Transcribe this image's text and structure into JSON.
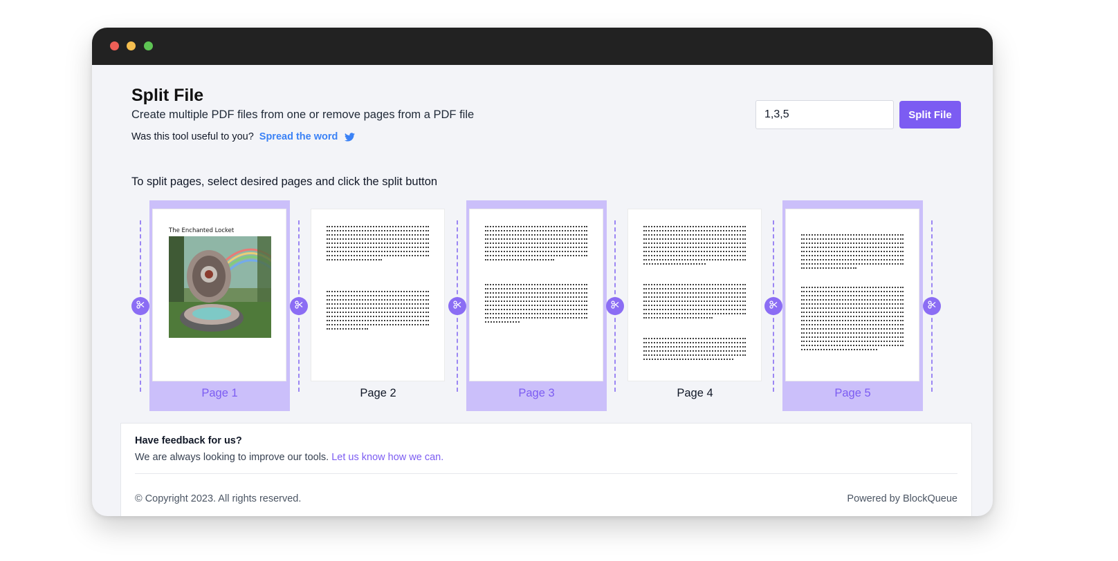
{
  "window": {
    "controls": [
      "close",
      "minimize",
      "maximize"
    ]
  },
  "header": {
    "title": "Split File",
    "subtitle": "Create multiple PDF files from one or remove pages from a PDF file",
    "useful_prompt": "Was this tool useful to you?",
    "share_link": "Spread the word",
    "share_icon": "twitter-icon"
  },
  "split_form": {
    "pages_value": "1,3,5",
    "button_label": "Split File",
    "accent_color": "#7c5cf2"
  },
  "instruction": "To split pages, select desired pages and click the split button",
  "pages": [
    {
      "label": "Page 1",
      "selected": true,
      "doc_title": "The Enchanted Locket",
      "has_image": true
    },
    {
      "label": "Page 2",
      "selected": false
    },
    {
      "label": "Page 3",
      "selected": true
    },
    {
      "label": "Page 4",
      "selected": false
    },
    {
      "label": "Page 5",
      "selected": true
    }
  ],
  "split_markers": {
    "count": 6,
    "icon": "scissors-icon"
  },
  "feedback": {
    "title": "Have feedback for us?",
    "text": "We are always looking to improve our tools.",
    "link": "Let us know how we can."
  },
  "footer": {
    "copyright": "© Copyright 2023. All rights reserved.",
    "powered_by": "Powered by BlockQueue"
  }
}
